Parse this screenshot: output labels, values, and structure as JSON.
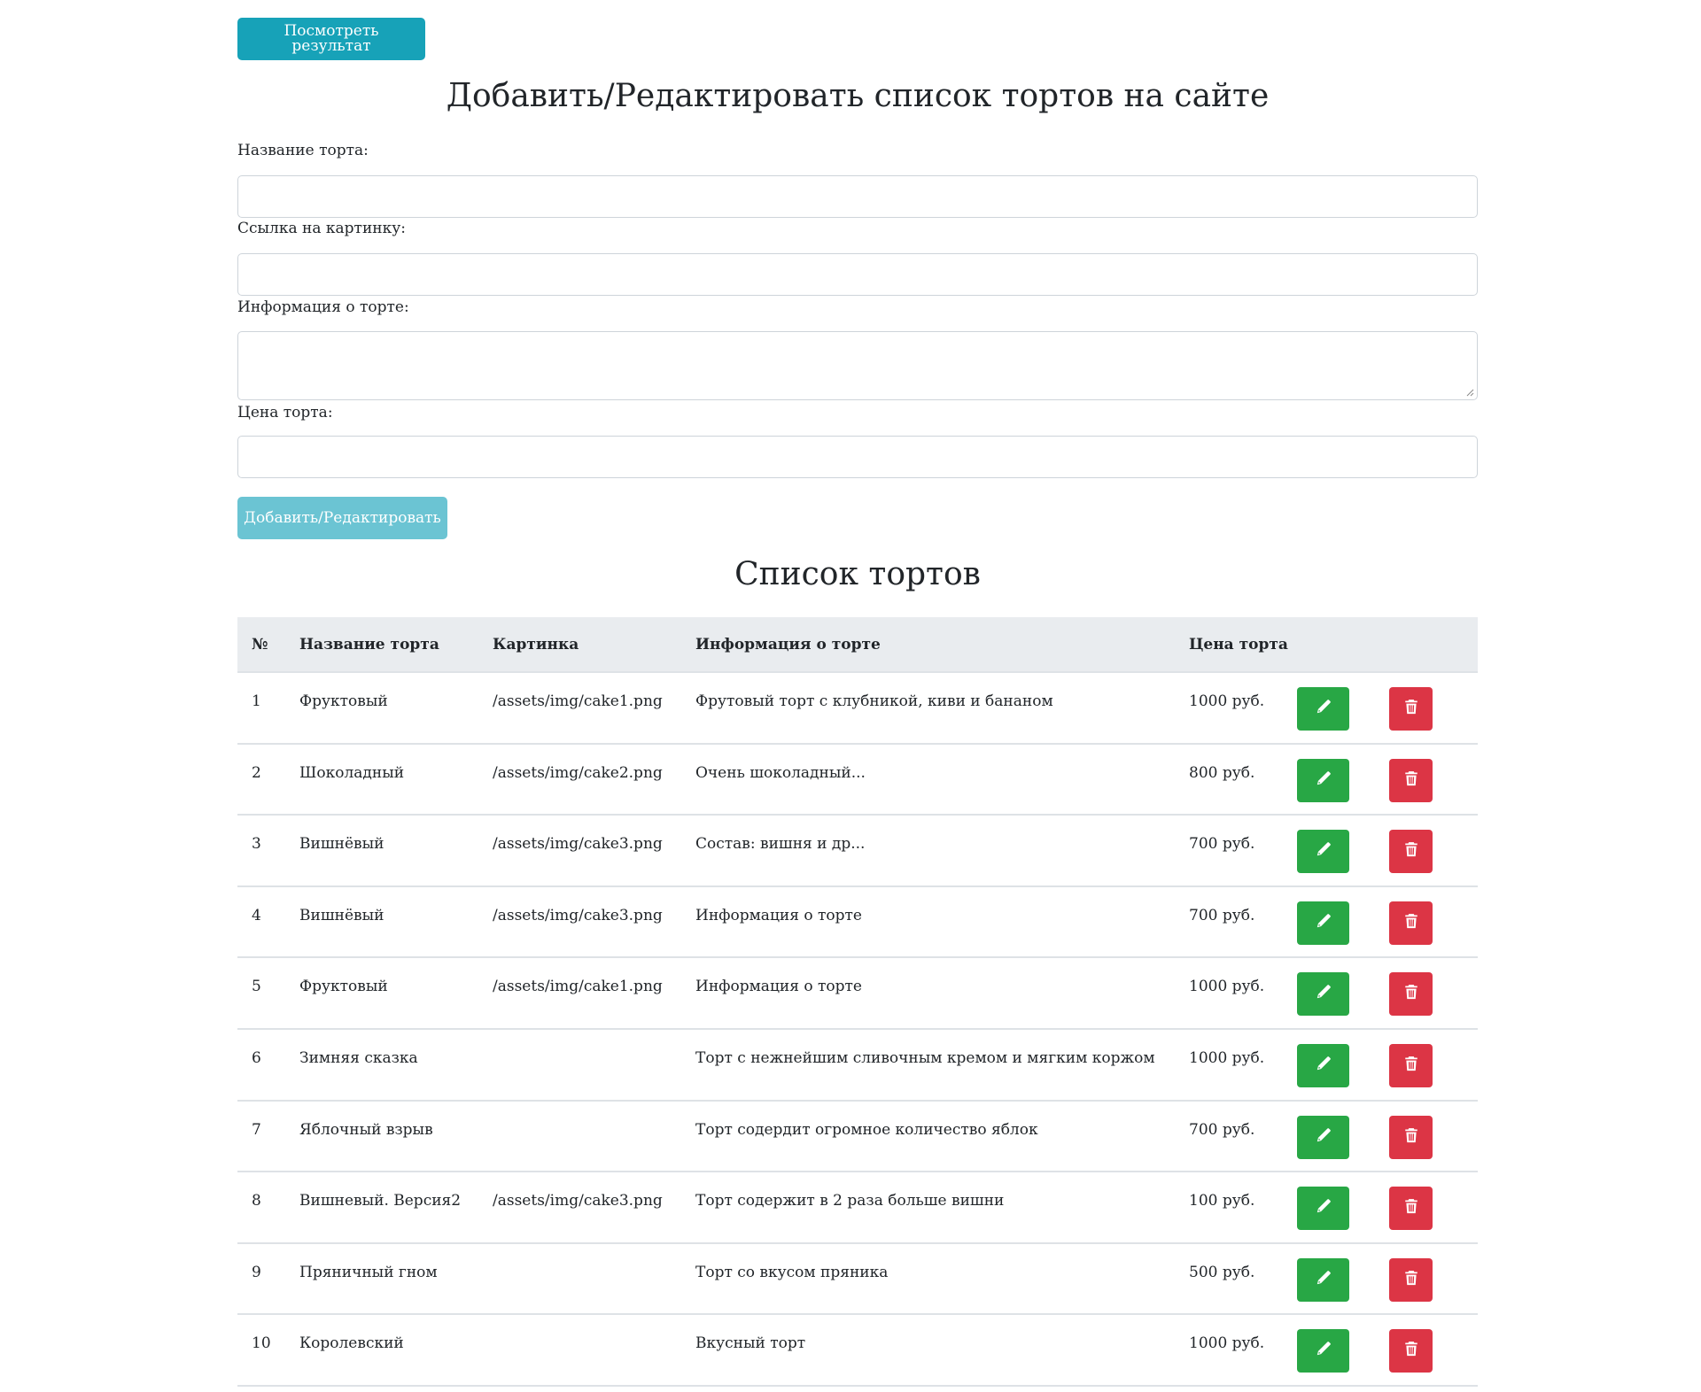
{
  "header": {
    "view_result_label": "Посмотреть результат"
  },
  "form": {
    "title": "Добавить/Редактировать список тортов на сайте",
    "name_label": "Название торта:",
    "name_value": "",
    "image_label": "Ссылка на картинку:",
    "image_value": "",
    "info_label": "Информация о торте:",
    "info_value": "",
    "price_label": "Цена торта:",
    "price_value": "",
    "submit_label": "Добавить/Редактировать"
  },
  "list": {
    "title": "Список тортов",
    "columns": [
      "№",
      "Название торта",
      "Картинка",
      "Информация о торте",
      "Цена торта"
    ],
    "rows": [
      {
        "num": "1",
        "name": "Фруктовый",
        "image": "/assets/img/cake1.png",
        "info": "Фрутовый торт с клубникой, киви и бананом",
        "price": "1000 руб."
      },
      {
        "num": "2",
        "name": "Шоколадный",
        "image": "/assets/img/cake2.png",
        "info": "Очень шоколадный...",
        "price": "800 руб."
      },
      {
        "num": "3",
        "name": "Вишнёвый",
        "image": "/assets/img/cake3.png",
        "info": "Состав: вишня и др...",
        "price": "700 руб."
      },
      {
        "num": "4",
        "name": "Вишнёвый",
        "image": "/assets/img/cake3.png",
        "info": "Информация о торте",
        "price": "700 руб."
      },
      {
        "num": "5",
        "name": "Фруктовый",
        "image": "/assets/img/cake1.png",
        "info": "Информация о торте",
        "price": "1000 руб."
      },
      {
        "num": "6",
        "name": "Зимняя сказка",
        "image": "",
        "info": "Торт с нежнейшим сливочным кремом и мягким коржом",
        "price": "1000 руб."
      },
      {
        "num": "7",
        "name": "Яблочный взрыв",
        "image": "",
        "info": "Торт содердит огромное количество яблок",
        "price": "700 руб."
      },
      {
        "num": "8",
        "name": "Вишневый. Версия2",
        "image": "/assets/img/cake3.png",
        "info": "Торт содержит в 2 раза больше вишни",
        "price": "100 руб."
      },
      {
        "num": "9",
        "name": "Пряничный гном",
        "image": "",
        "info": "Торт со вкусом пряника",
        "price": "500 руб."
      },
      {
        "num": "10",
        "name": "Королевский",
        "image": "",
        "info": "Вкусный торт",
        "price": "1000 руб."
      }
    ]
  },
  "icons": {
    "edit": "pencil-icon",
    "delete": "trash-icon"
  },
  "colors": {
    "info": "#17a2b8",
    "info_light": "#6bc4d3",
    "success": "#28a745",
    "danger": "#dc3545",
    "table_head": "#e9ecef"
  }
}
